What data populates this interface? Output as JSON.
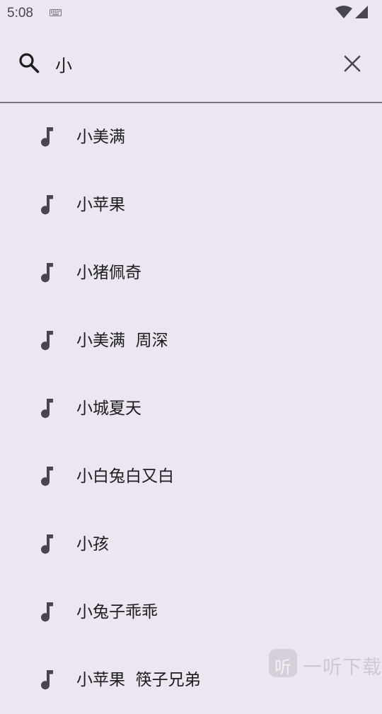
{
  "status_bar": {
    "time": "5:08",
    "icons": [
      "keyboard-icon",
      "wifi-icon",
      "signal-icon"
    ]
  },
  "search": {
    "value": "小",
    "icon": "search-icon",
    "clear_icon": "close-icon"
  },
  "suggestions": [
    {
      "label": "小美满",
      "icon": "music-note-icon"
    },
    {
      "label": "小苹果",
      "icon": "music-note-icon"
    },
    {
      "label": "小猪佩奇",
      "icon": "music-note-icon"
    },
    {
      "label": "小美满  周深",
      "icon": "music-note-icon"
    },
    {
      "label": "小城夏天",
      "icon": "music-note-icon"
    },
    {
      "label": "小白兔白又白",
      "icon": "music-note-icon"
    },
    {
      "label": "小孩",
      "icon": "music-note-icon"
    },
    {
      "label": "小兔子乖乖",
      "icon": "music-note-icon"
    },
    {
      "label": "小苹果  筷子兄弟",
      "icon": "music-note-icon"
    }
  ],
  "watermark": {
    "logo_char": "听",
    "text": "一听下载"
  },
  "colors": {
    "background": "#ece6f0",
    "text": "#1d1b20",
    "icon": "#49454f",
    "divider": "#79747e"
  }
}
